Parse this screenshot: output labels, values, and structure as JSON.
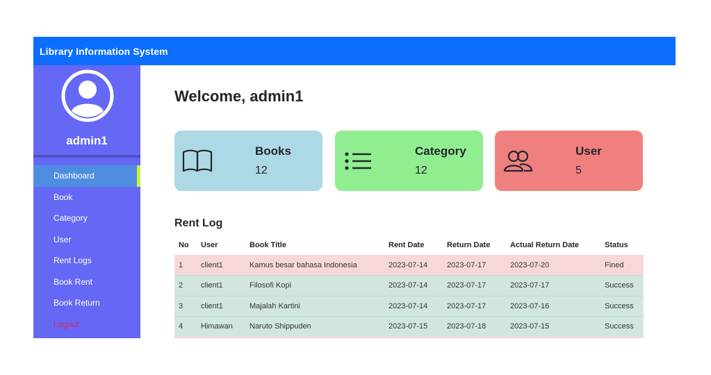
{
  "navbar": {
    "brand": "Library Information System"
  },
  "sidebar": {
    "username": "admin1",
    "menu": [
      {
        "label": "Dashboard",
        "active": true
      },
      {
        "label": "Book"
      },
      {
        "label": "Category"
      },
      {
        "label": "User"
      },
      {
        "label": "Rent Logs"
      },
      {
        "label": "Book Rent"
      },
      {
        "label": "Book Return"
      },
      {
        "label": "Logout"
      }
    ]
  },
  "main": {
    "welcome": "Welcome, admin1",
    "cards": [
      {
        "title": "Books",
        "count": "12",
        "icon": "book-icon",
        "color": "#add8e6"
      },
      {
        "title": "Category",
        "count": "12",
        "icon": "list-icon",
        "color": "#90ee90"
      },
      {
        "title": "User",
        "count": "5",
        "icon": "users-icon",
        "color": "#f08080"
      }
    ],
    "rent_log": {
      "title": "Rent Log",
      "columns": [
        "No",
        "User",
        "Book Title",
        "Rent Date",
        "Return Date",
        "Actual Return Date",
        "Status"
      ],
      "rows": [
        [
          "1",
          "client1",
          "Kamus besar bahasa Indonesia",
          "2023-07-14",
          "2023-07-17",
          "2023-07-20",
          "Fined"
        ],
        [
          "2",
          "client1",
          "Filosofi Kopi",
          "2023-07-14",
          "2023-07-17",
          "2023-07-17",
          "Success"
        ],
        [
          "3",
          "client1",
          "Majalah Kartini",
          "2023-07-14",
          "2023-07-17",
          "2023-07-16",
          "Success"
        ],
        [
          "4",
          "Himawan",
          "Naruto Shippuden",
          "2023-07-15",
          "2023-07-18",
          "2023-07-15",
          "Success"
        ]
      ]
    }
  },
  "colors": {
    "navbar": "#0d6efd",
    "sidebar": "#6568f5",
    "active_item": "#4f8de0",
    "active_indicator": "#d4ec3a",
    "logout": "#e0245e",
    "fined_row": "#f8d7da",
    "success_row": "#d1e7dd"
  }
}
